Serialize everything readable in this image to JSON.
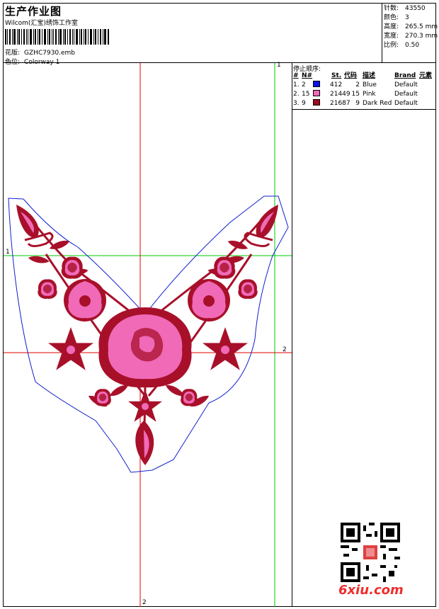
{
  "header": {
    "title": "生产作业图",
    "company": "Wilcom(汇宝)绣饰工作室",
    "pattern_label": "花版:",
    "pattern_value": "GZHC7930.emb",
    "colorway_label": "色位:",
    "colorway_value": "Colorway 1"
  },
  "stats": [
    {
      "label": "针数:",
      "value": "43550"
    },
    {
      "label": "颜色:",
      "value": "3"
    },
    {
      "label": "高度:",
      "value": "265.5 mm"
    },
    {
      "label": "宽度:",
      "value": "270.3 mm"
    },
    {
      "label": "比例:",
      "value": "0.50"
    }
  ],
  "stop_sequence": {
    "heading": "停止顺序:",
    "columns": [
      "#",
      "N#",
      "St.",
      "代码",
      "描述",
      "Brand",
      "元素"
    ],
    "rows": [
      {
        "idx": "1.",
        "n": "2",
        "stitches": "412",
        "code": "2",
        "desc": "Blue",
        "brand": "Default",
        "color": "#0a14e6"
      },
      {
        "idx": "2.",
        "n": "15",
        "stitches": "21449",
        "code": "15",
        "desc": "Pink",
        "brand": "Default",
        "color": "#f06ab8"
      },
      {
        "idx": "3.",
        "n": "9",
        "stitches": "21687",
        "code": "9",
        "desc": "Dark Red",
        "brand": "Default",
        "color": "#9e0a1e"
      }
    ]
  },
  "guides": {
    "v1_label": "1",
    "h1_label": "1",
    "h2_label": "2",
    "v2_label": "2"
  },
  "colors": {
    "guide_green": "#00c800",
    "guide_red": "#e00000",
    "outline_blue": "#1020d0",
    "petal_pink": "#f06ab8",
    "dark_red": "#a8102a"
  },
  "watermark": "6xiu.com"
}
